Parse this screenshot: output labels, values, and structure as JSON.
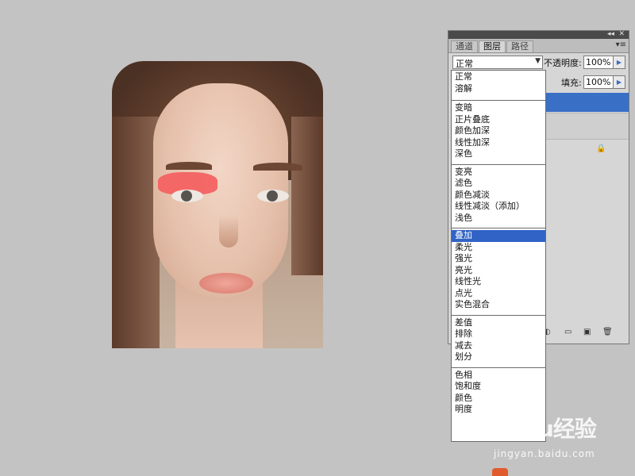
{
  "panel": {
    "tabs": [
      "通道",
      "图层",
      "路径"
    ],
    "active_tab": 1,
    "collapse_icon": "double-chevron-icon",
    "close_icon": "close-icon",
    "menu_icon": "panel-menu-icon"
  },
  "blend": {
    "current": "正常",
    "arrow_icon": "chevron-down-icon"
  },
  "opacity": {
    "label": "不透明度:",
    "value": "100%"
  },
  "fill": {
    "label": "填充:",
    "value": "100%"
  },
  "dropdown": {
    "groups": [
      [
        "正常",
        "溶解"
      ],
      [
        "变暗",
        "正片叠底",
        "颜色加深",
        "线性加深",
        "深色"
      ],
      [
        "变亮",
        "滤色",
        "颜色减淡",
        "线性减淡（添加）",
        "浅色"
      ],
      [
        "叠加",
        "柔光",
        "强光",
        "亮光",
        "线性光",
        "点光",
        "实色混合"
      ],
      [
        "差值",
        "排除",
        "减去",
        "划分"
      ],
      [
        "色相",
        "饱和度",
        "颜色",
        "明度"
      ]
    ],
    "selected": "叠加"
  },
  "watermark": {
    "logo": "Baidu经验",
    "url": "jingyan.baidu.com"
  },
  "colors": {
    "canvas_bg": "#c3c3c3",
    "selection": "#3163c6",
    "eyeshadow": "#f36262"
  }
}
